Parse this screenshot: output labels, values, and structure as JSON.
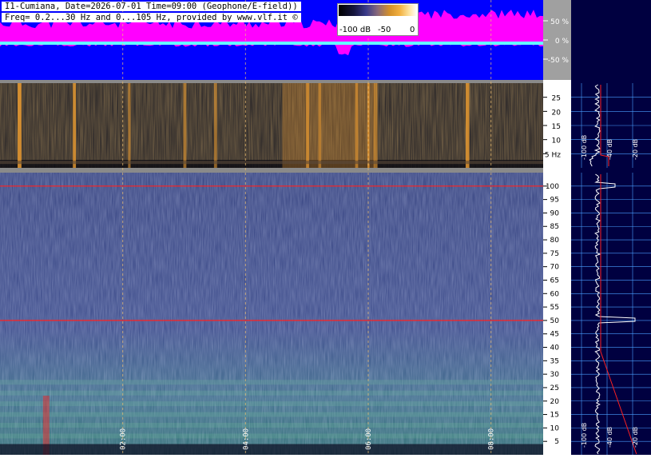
{
  "header": {
    "title_line": "I1-Cumiana, Date=2026-07-01 Time=09:00 (Geophone/E-field))",
    "freq_line": "Freq= 0.2...30 Hz and 0...105 Hz, provided by www.vlf.it ©"
  },
  "colorbar": {
    "labels": [
      "-100 dB",
      "-50",
      "0"
    ]
  },
  "colors": {
    "amplitude_bg": "#0000ff",
    "amplitude_fill": "#ff00ff",
    "amplitude_trace": "#66ffff",
    "right_panel_bg": "#000040",
    "grid_line": "#4aa0ff",
    "reference_line": "#ff2020"
  },
  "chart_data": [
    {
      "type": "area",
      "panel": "amplitude",
      "y_ticks": [
        "50 %",
        "0 %",
        "-50 %"
      ],
      "ylim": [
        -100,
        100
      ]
    },
    {
      "type": "heatmap",
      "panel": "spectrogram-low",
      "y_ticks": [
        "25",
        "20",
        "15",
        "10",
        "5 Hz"
      ],
      "ylim": [
        0,
        30
      ],
      "highlight_hours": [
        0.3,
        1.2,
        2.1,
        3.0,
        3.5,
        5.0,
        5.2,
        5.8,
        6.0,
        6.1,
        7.6
      ]
    },
    {
      "type": "heatmap",
      "panel": "spectrogram-high",
      "y_ticks": [
        "100",
        "95",
        "90",
        "85",
        "80",
        "75",
        "70",
        "65",
        "60",
        "55",
        "50",
        "45",
        "40",
        "35",
        "30",
        "25",
        "20",
        "15",
        "10",
        "5"
      ],
      "ylim": [
        0,
        105
      ],
      "x_ticks": [
        "02:00",
        "04:00",
        "06:00",
        "08:00"
      ],
      "xlim_hours": [
        0,
        8.85
      ],
      "reference_lines_hz": [
        50,
        100
      ]
    },
    {
      "type": "line",
      "panel": "spectrum-low",
      "x_tick_labels": [
        "-100 dB",
        "-40 dB",
        "-20 dB"
      ]
    },
    {
      "type": "line",
      "panel": "spectrum-high",
      "x_tick_labels": [
        "-100 dB",
        "-40 dB",
        "-20 dB"
      ]
    }
  ]
}
